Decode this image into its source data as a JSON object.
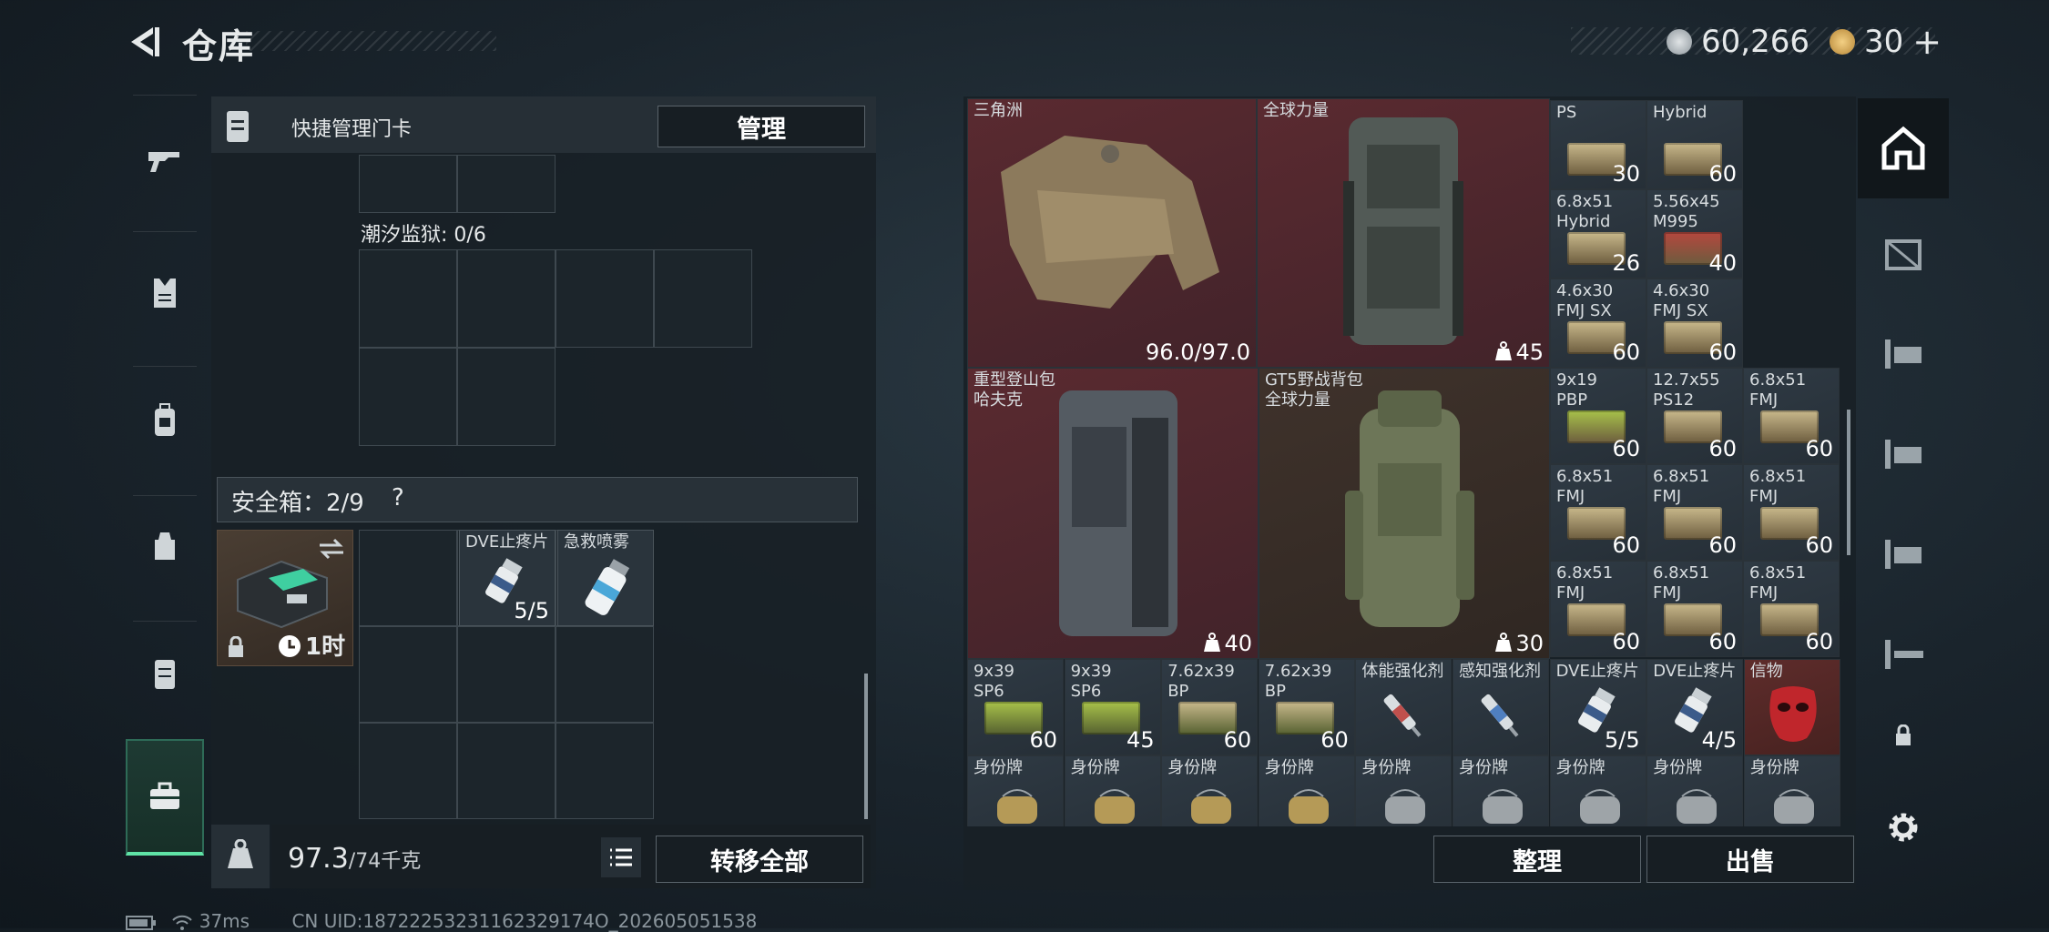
{
  "header": {
    "title": "仓库",
    "currency_silver": "60,266",
    "currency_gold": "30",
    "plus": "+"
  },
  "left_panel": {
    "quick_card_label": "快捷管理门卡",
    "manage_button": "管理",
    "prison_label": "潮汐监狱: 0/6",
    "safe_box_label": "安全箱：2/9",
    "help": "?",
    "safe_box_timer": "1时",
    "safe_items": [
      {
        "name": "DVE止疼片",
        "count": "5/5"
      },
      {
        "name": "急救喷雾",
        "count": ""
      }
    ],
    "weight": "97.3",
    "weight_max": "/74千克",
    "transfer_all_button": "转移全部"
  },
  "inventory": {
    "vest": {
      "name": "三角洲",
      "durability": "96.0/97.0"
    },
    "backpack1": {
      "name": "全球力量",
      "count": "45"
    },
    "backpack2": {
      "name": "重型登山包\n哈夫克",
      "count": "40"
    },
    "backpack3": {
      "name": "GT5野战背包\n全球力量",
      "count": "30"
    },
    "ammo_grid": [
      {
        "name": "PS",
        "count": "30",
        "color": "#c9b98c"
      },
      {
        "name": "Hybrid",
        "count": "60",
        "color": "#c9b98c"
      },
      {
        "name": "6.8x51\nHybrid",
        "count": "26",
        "color": "#c9b98c"
      },
      {
        "name": "5.56x45\nM995",
        "count": "40",
        "color": "#b5473e"
      },
      {
        "name": "4.6x30\nFMJ SX",
        "count": "60",
        "color": "#c9b98c"
      },
      {
        "name": "4.6x30\nFMJ SX",
        "count": "60",
        "color": "#c9b98c"
      },
      {
        "name": "9x19\nPBP",
        "count": "60",
        "color": "#a8c24a"
      },
      {
        "name": "12.7x55\nPS12",
        "count": "60",
        "color": "#c9b98c"
      },
      {
        "name": "6.8x51\nFMJ",
        "count": "60",
        "color": "#c9b98c"
      },
      {
        "name": "6.8x51\nFMJ",
        "count": "60",
        "color": "#c9b98c"
      },
      {
        "name": "6.8x51\nFMJ",
        "count": "60",
        "color": "#c9b98c"
      },
      {
        "name": "6.8x51\nFMJ",
        "count": "60",
        "color": "#c9b98c"
      },
      {
        "name": "6.8x51\nFMJ",
        "count": "60",
        "color": "#c9b98c"
      },
      {
        "name": "6.8x51\nFMJ",
        "count": "60",
        "color": "#c9b98c"
      },
      {
        "name": "6.8x51\nFMJ",
        "count": "60",
        "color": "#c9b98c"
      }
    ],
    "row5": [
      {
        "name": "9x39\nSP6",
        "count": "60",
        "kind": "ammo",
        "color": "#a8c24a"
      },
      {
        "name": "9x39\nSP6",
        "count": "45",
        "kind": "ammo",
        "color": "#a8c24a"
      },
      {
        "name": "7.62x39\nBP",
        "count": "60",
        "kind": "ammo",
        "color": "#c9b98c"
      },
      {
        "name": "7.62x39\nBP",
        "count": "60",
        "kind": "ammo",
        "color": "#c9b98c"
      },
      {
        "name": "体能强化剂",
        "count": "",
        "kind": "syringe",
        "color": "#c0504d"
      },
      {
        "name": "感知强化剂",
        "count": "",
        "kind": "syringe",
        "color": "#4f7fc0"
      },
      {
        "name": "DVE止疼片",
        "count": "5/5",
        "kind": "pills",
        "color": "#e6e9ea"
      },
      {
        "name": "DVE止疼片",
        "count": "4/5",
        "kind": "pills",
        "color": "#e6e9ea"
      },
      {
        "name": "信物",
        "count": "",
        "kind": "mask",
        "color": "#c0262c"
      }
    ],
    "dogtag_label": "身份牌",
    "dogtag_colors": [
      "#b59a57",
      "#b59a57",
      "#b59a57",
      "#b59a57",
      "#9ea4a8",
      "#9ea4a8",
      "#9ea4a8",
      "#9ea4a8",
      "#9ea4a8"
    ]
  },
  "bottom_buttons": {
    "sort": "整理",
    "sell": "出售"
  },
  "footer": {
    "ping": "37ms",
    "uid": "CN UID:18722253231162329174O_202605051538"
  },
  "colors": {
    "accent_green": "#5fe3a6",
    "backpack_red": "#5a2a30"
  }
}
